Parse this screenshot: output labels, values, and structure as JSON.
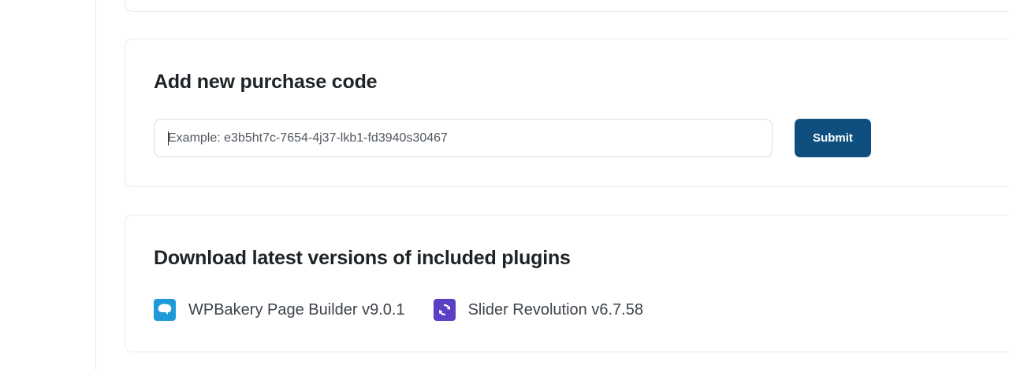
{
  "purchase": {
    "title": "Add new purchase code",
    "input_placeholder": "Example: e3b5ht7c-7654-4j37-lkb1-fd3940s30467",
    "input_value": "",
    "submit_label": "Submit"
  },
  "plugins": {
    "title": "Download latest versions of included plugins",
    "items": [
      {
        "label": "WPBakery Page Builder v9.0.1",
        "icon": "wpbakery-icon",
        "color": "#1e9bd7"
      },
      {
        "label": "Slider Revolution v6.7.58",
        "icon": "slider-revolution-icon",
        "color": "#5b3fc4"
      }
    ]
  },
  "colors": {
    "submit_button": "#0e4f80",
    "card_border": "#e9e9e9"
  }
}
